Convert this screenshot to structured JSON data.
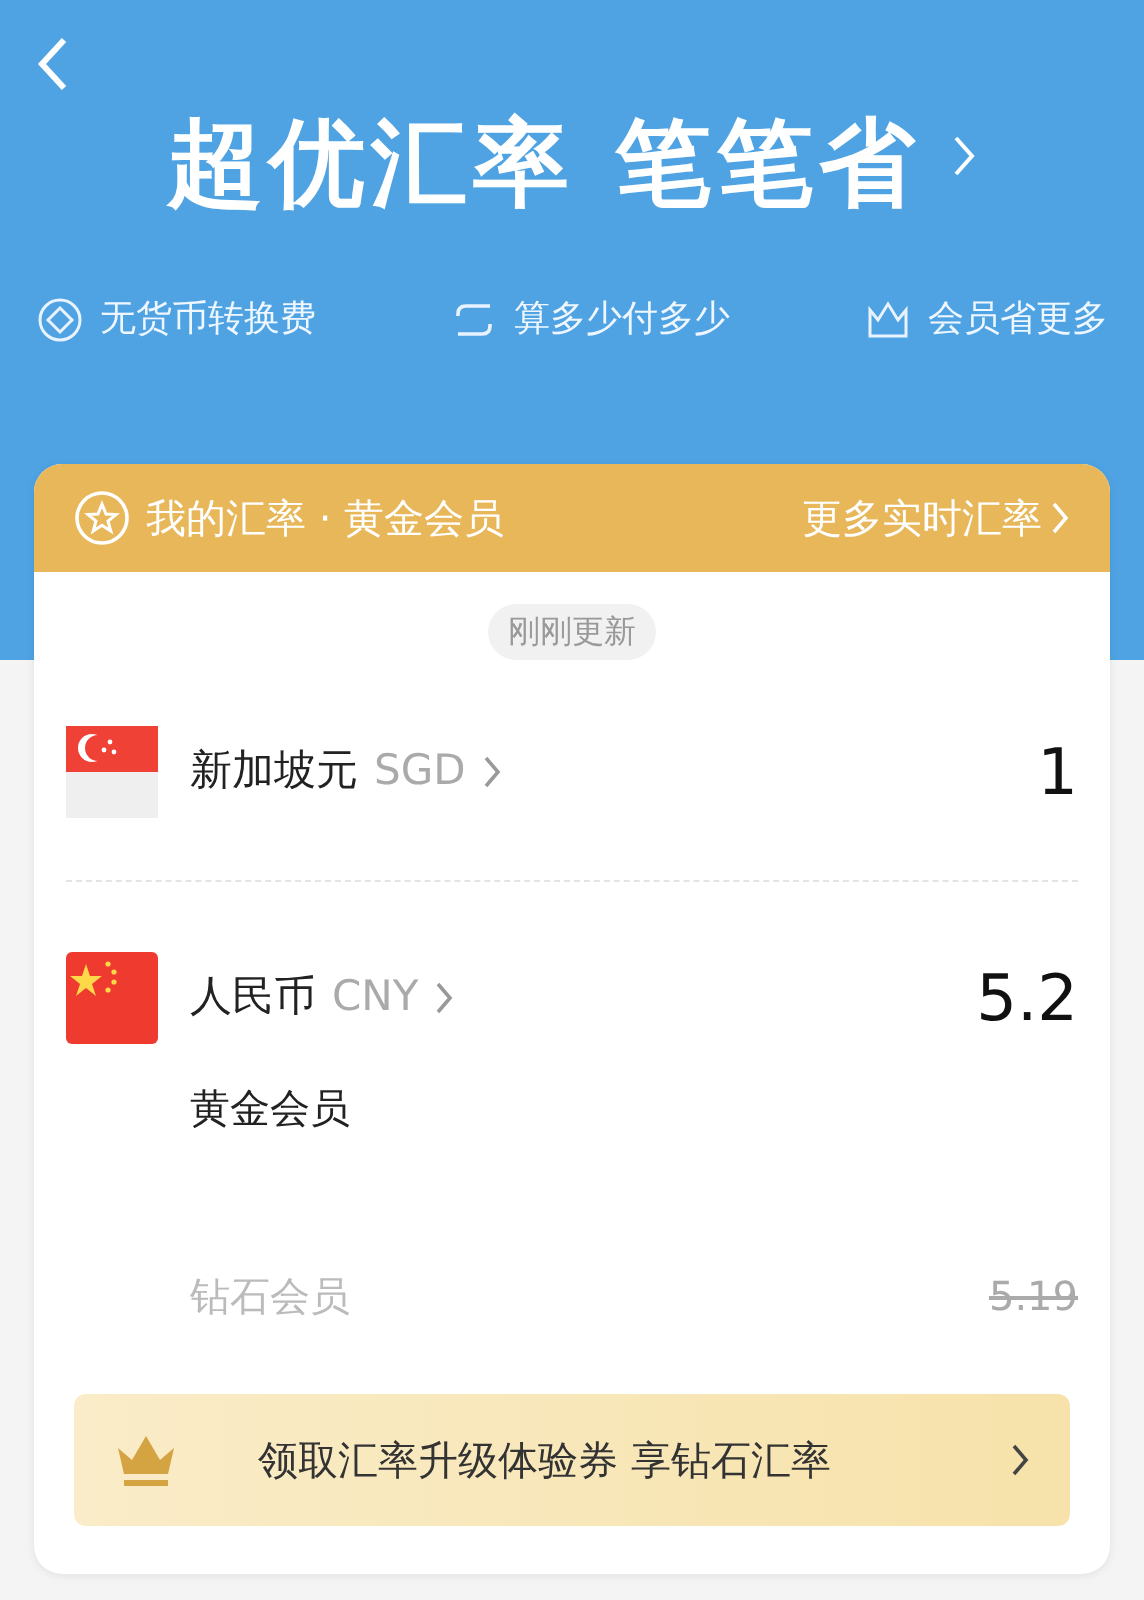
{
  "header": {
    "title": "超优汇率 笔笔省"
  },
  "features": [
    {
      "kind": "coin",
      "label": "无货币转换费"
    },
    {
      "kind": "swap",
      "label": "算多少付多少"
    },
    {
      "kind": "crown",
      "label": "会员省更多"
    }
  ],
  "card": {
    "title": "我的汇率 · 黄金会员",
    "link": "更多实时汇率",
    "updated": "刚刚更新"
  },
  "currencies": [
    {
      "kind": "sg",
      "name": "新加坡元",
      "code": "SGD",
      "value": "1"
    },
    {
      "kind": "cn",
      "name": "人民币",
      "code": "CNY",
      "value": "5.2",
      "tiers": [
        {
          "label": "黄金会员",
          "current": true
        },
        {
          "label": "钻石会员",
          "value": "5.19",
          "current": false
        }
      ]
    }
  ],
  "promo": {
    "text": "领取汇率升级体验券 享钻石汇率"
  }
}
